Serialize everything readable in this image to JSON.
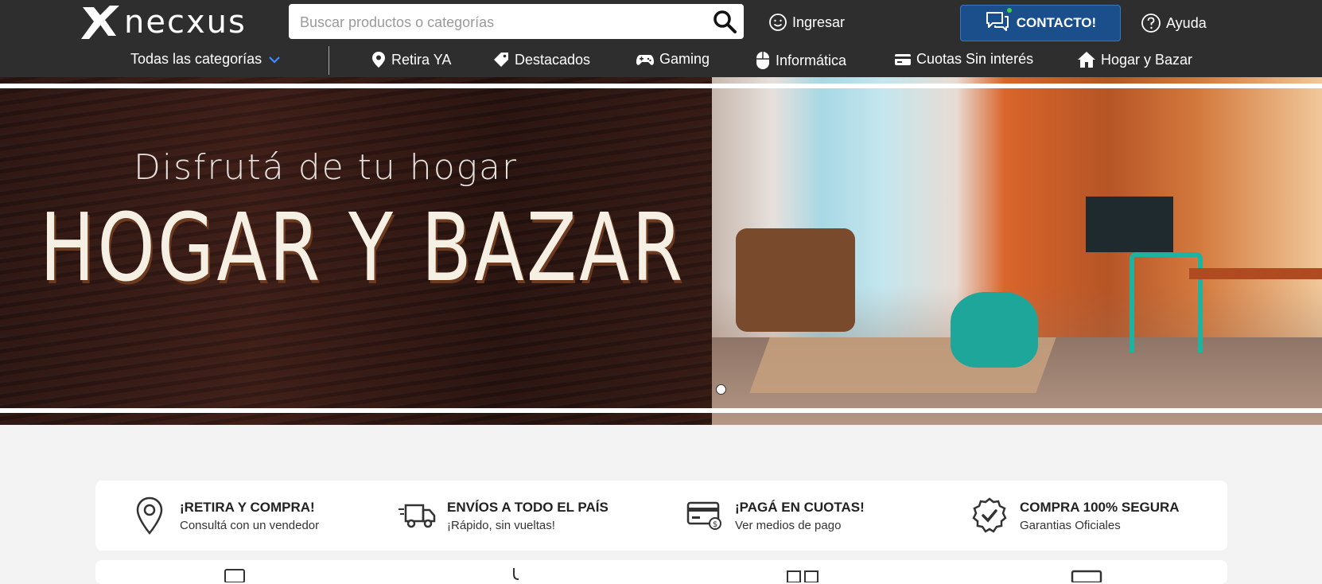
{
  "header": {
    "brand": "necxus",
    "search_placeholder": "Buscar productos o categorías",
    "ingresar": "Ingresar",
    "contacto": "CONTACTO!",
    "ayuda": "Ayuda"
  },
  "nav": {
    "all_categories": "Todas las categorías",
    "items": [
      {
        "label": "Retira YA",
        "icon": "location-pin-icon"
      },
      {
        "label": "Destacados",
        "icon": "tag-icon"
      },
      {
        "label": "Gaming",
        "icon": "gamepad-icon"
      },
      {
        "label": "Informática",
        "icon": "mouse-icon"
      },
      {
        "label": "Cuotas Sin interés",
        "icon": "credit-card-icon"
      },
      {
        "label": "Hogar y Bazar",
        "icon": "home-icon"
      }
    ]
  },
  "hero": {
    "subtitle": "Disfrutá de tu hogar",
    "title": "HOGAR Y BAZAR"
  },
  "features": [
    {
      "title": "¡RETIRA Y COMPRA!",
      "subtitle": "Consultá con un vendedor",
      "icon": "map-pin-icon"
    },
    {
      "title": "ENVÍOS A TODO EL PAÍS",
      "subtitle": "¡Rápido, sin vueltas!",
      "icon": "truck-icon"
    },
    {
      "title": "¡PAGÁ EN CUOTAS!",
      "subtitle": "Ver medios de pago",
      "icon": "card-payment-icon"
    },
    {
      "title": "COMPRA 100% SEGURA",
      "subtitle": "Garantias Oficiales",
      "icon": "verified-badge-icon"
    }
  ],
  "colors": {
    "header_bg": "#2e2e2e",
    "contact_bg": "#1a4f8b",
    "page_bg": "#f3f3f3"
  }
}
